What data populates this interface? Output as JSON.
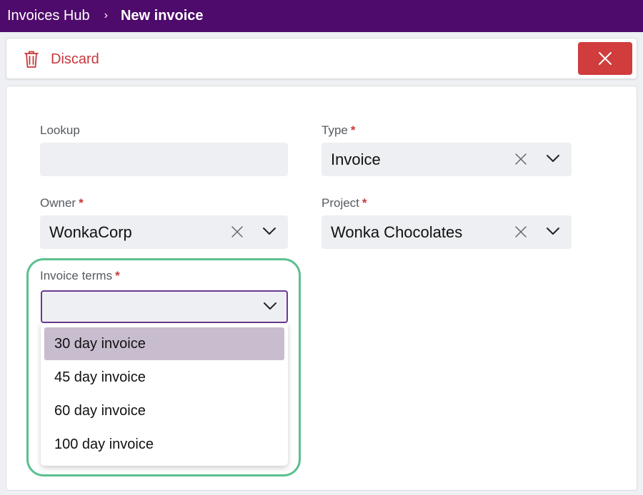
{
  "breadcrumb": {
    "root": "Invoices Hub",
    "separator": "›",
    "current": "New invoice"
  },
  "toolbar": {
    "discard_label": "Discard",
    "discard_icon": "trash-icon",
    "close_icon": "close-icon",
    "close_color": "#d13c3c",
    "discard_color": "#c8373b"
  },
  "form": {
    "lookup": {
      "label": "Lookup",
      "required": false,
      "value": ""
    },
    "type": {
      "label": "Type",
      "required_mark": "*",
      "value": "Invoice"
    },
    "owner": {
      "label": "Owner",
      "required_mark": "*",
      "value": "WonkaCorp"
    },
    "project": {
      "label": "Project",
      "required_mark": "*",
      "value": "Wonka Chocolates"
    },
    "invoice_terms": {
      "label": "Invoice terms",
      "required_mark": "*",
      "value": "",
      "options": [
        "30 day invoice",
        "45 day invoice",
        "60 day invoice",
        "100 day invoice"
      ],
      "highlighted_option": "30 day invoice"
    }
  },
  "colors": {
    "header_bg": "#4e0b6b",
    "focus_border": "#6c3a8f",
    "highlight_option": "#c8bccf",
    "annotation_ring": "#5cc090"
  }
}
